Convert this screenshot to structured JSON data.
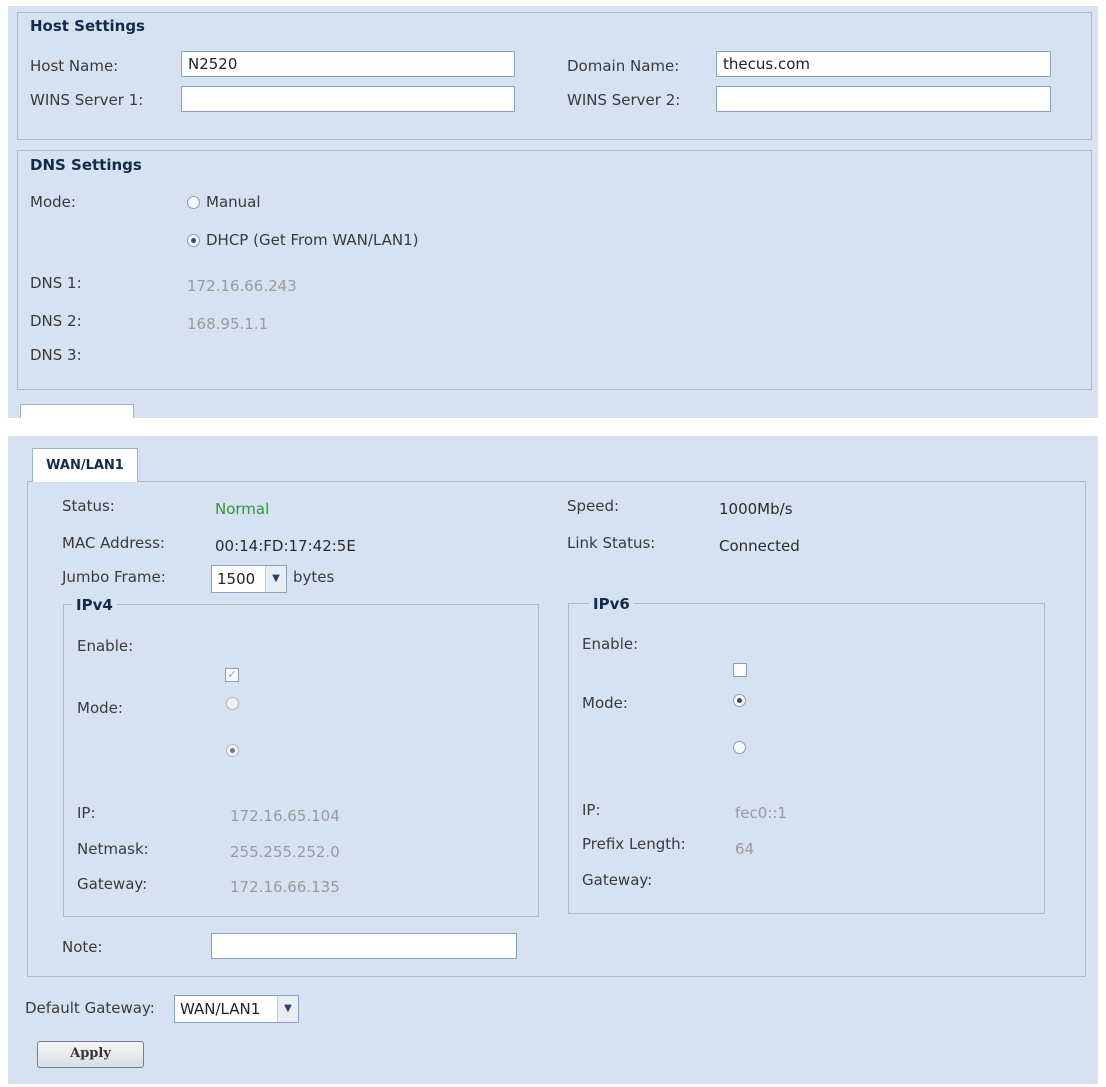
{
  "host_settings": {
    "title": "Host Settings",
    "host_name_label": "Host Name:",
    "host_name_value": "N2520",
    "domain_name_label": "Domain Name:",
    "domain_name_value": "thecus.com",
    "wins1_label": "WINS Server 1:",
    "wins1_value": "",
    "wins2_label": "WINS Server 2:",
    "wins2_value": ""
  },
  "dns_settings": {
    "title": "DNS Settings",
    "mode_label": "Mode:",
    "manual_label": "Manual",
    "dhcp_label": "DHCP (Get From WAN/LAN1)",
    "selected_mode": "DHCP",
    "dns1_label": "DNS 1:",
    "dns1_value": "172.16.66.243",
    "dns2_label": "DNS 2:",
    "dns2_value": "168.95.1.1",
    "dns3_label": "DNS 3:",
    "dns3_value": ""
  },
  "interface": {
    "tab_label": "WAN/LAN1",
    "status_label": "Status:",
    "status_value": "Normal",
    "status_color": "#2e9a2e",
    "speed_label": "Speed:",
    "speed_value": "1000Mb/s",
    "mac_label": "MAC Address:",
    "mac_value": "00:14:FD:17:42:5E",
    "link_status_label": "Link Status:",
    "link_status_value": "Connected",
    "jumbo_label": "Jumbo Frame:",
    "jumbo_value": "1500",
    "jumbo_unit": "bytes",
    "note_label": "Note:",
    "note_value": ""
  },
  "ipv4": {
    "title": "IPv4",
    "enable_label": "Enable:",
    "enabled": true,
    "mode_label": "Mode:",
    "ip_label": "IP:",
    "ip_value": "172.16.65.104",
    "netmask_label": "Netmask:",
    "netmask_value": "255.255.252.0",
    "gateway_label": "Gateway:",
    "gateway_value": "172.16.66.135"
  },
  "ipv6": {
    "title": "IPv6",
    "enable_label": "Enable:",
    "enabled": false,
    "mode_label": "Mode:",
    "ip_label": "IP:",
    "ip_value": "fec0::1",
    "prefix_label": "Prefix Length:",
    "prefix_value": "64",
    "gateway_label": "Gateway:",
    "gateway_value": ""
  },
  "footer": {
    "default_gateway_label": "Default Gateway:",
    "default_gateway_value": "WAN/LAN1",
    "apply_label": "Apply"
  },
  "colors": {
    "panel_bg": "#d6e2f1",
    "border": "#a7bbd6",
    "heading": "#15294a"
  }
}
